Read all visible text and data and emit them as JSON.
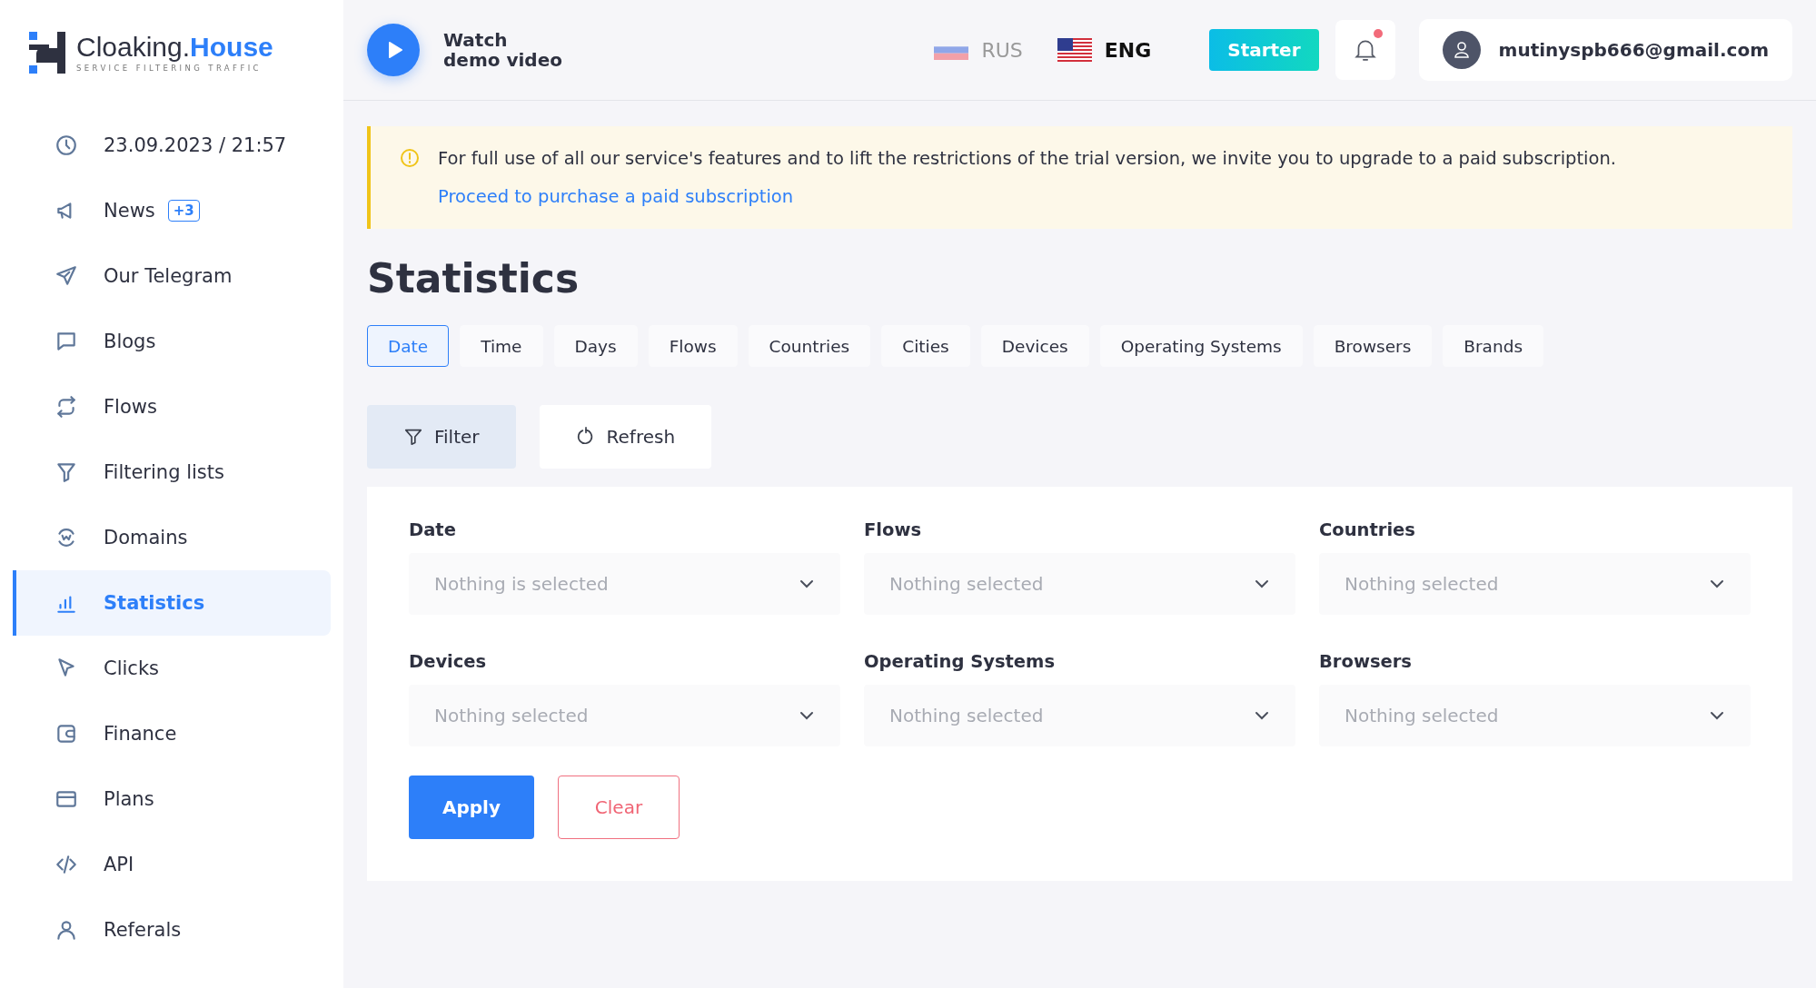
{
  "logo": {
    "name": "Cloaking.",
    "name_accent": "House",
    "tagline": "SERVICE FILTERING TRAFFIC"
  },
  "sidebar": {
    "items": [
      {
        "label": "23.09.2023 / 21:57",
        "selected": false
      },
      {
        "label": "News",
        "badge": "+3",
        "selected": false
      },
      {
        "label": "Our Telegram",
        "selected": false
      },
      {
        "label": "Blogs",
        "selected": false
      },
      {
        "label": "Flows",
        "selected": false
      },
      {
        "label": "Filtering lists",
        "selected": false
      },
      {
        "label": "Domains",
        "selected": false
      },
      {
        "label": "Statistics",
        "selected": true
      },
      {
        "label": "Clicks",
        "selected": false
      },
      {
        "label": "Finance",
        "selected": false
      },
      {
        "label": "Plans",
        "selected": false
      },
      {
        "label": "API",
        "selected": false
      },
      {
        "label": "Referals",
        "selected": false
      }
    ]
  },
  "header": {
    "demo": "Watch\ndemo video",
    "languages": [
      {
        "label": "RUS",
        "selected": false
      },
      {
        "label": "ENG",
        "selected": true
      }
    ],
    "plan": "Starter",
    "notifications": {
      "unread": true
    },
    "account": "mutinyspb666@gmail.com"
  },
  "alert": {
    "message": "For full use of all our service's features and to lift the restrictions of the trial version, we invite you to upgrade to a paid subscription.",
    "link": "Proceed to purchase a paid subscription"
  },
  "title": "Statistics",
  "tabs": [
    {
      "label": "Date",
      "selected": true
    },
    {
      "label": "Time",
      "selected": false
    },
    {
      "label": "Days",
      "selected": false
    },
    {
      "label": "Flows",
      "selected": false
    },
    {
      "label": "Countries",
      "selected": false
    },
    {
      "label": "Cities",
      "selected": false
    },
    {
      "label": "Devices",
      "selected": false
    },
    {
      "label": "Operating Systems",
      "selected": false
    },
    {
      "label": "Browsers",
      "selected": false
    },
    {
      "label": "Brands",
      "selected": false
    }
  ],
  "actions": [
    {
      "label": "Filter",
      "selected": true
    },
    {
      "label": "Refresh",
      "selected": false
    }
  ],
  "filters": [
    {
      "label": "Date",
      "placeholder": "Nothing is selected"
    },
    {
      "label": "Flows",
      "placeholder": "Nothing selected"
    },
    {
      "label": "Countries",
      "placeholder": "Nothing selected"
    },
    {
      "label": "Devices",
      "placeholder": "Nothing selected"
    },
    {
      "label": "Operating Systems",
      "placeholder": "Nothing selected"
    },
    {
      "label": "Browsers",
      "placeholder": "Nothing selected"
    }
  ],
  "buttons": {
    "apply": "Apply",
    "clear": "Clear"
  }
}
